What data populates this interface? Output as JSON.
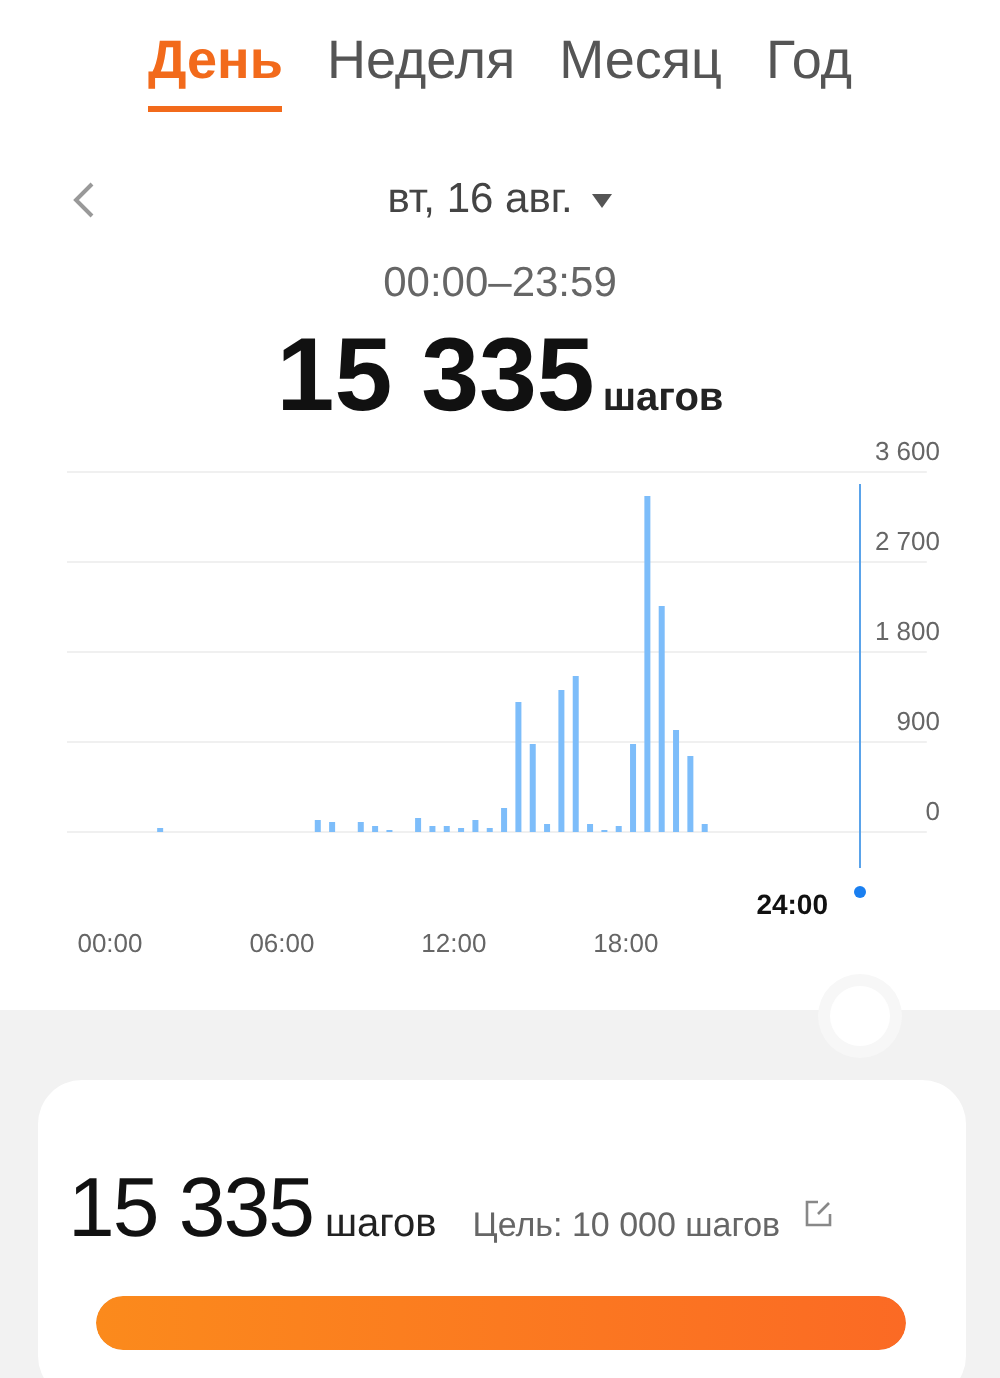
{
  "tabs": [
    {
      "label": "День",
      "selected": true
    },
    {
      "label": "Неделя",
      "selected": false
    },
    {
      "label": "Месяц",
      "selected": false
    },
    {
      "label": "Год",
      "selected": false
    }
  ],
  "date": "вт, 16 авг.",
  "time_range": "00:00–23:59",
  "total": {
    "value": "15 335",
    "unit": "шагов"
  },
  "chart": {
    "cursor_label": "24:00",
    "chart_data": {
      "type": "bar",
      "x": [
        1.75,
        7.25,
        7.75,
        8.75,
        9.25,
        9.75,
        10.75,
        11.25,
        11.75,
        12.25,
        12.75,
        13.25,
        13.75,
        14.25,
        14.75,
        15.25,
        15.75,
        16.25,
        16.75,
        17.25,
        17.75,
        18.25,
        18.75,
        19.25,
        19.75,
        20.25,
        20.75
      ],
      "values": [
        40,
        120,
        100,
        100,
        60,
        20,
        140,
        60,
        60,
        40,
        120,
        40,
        240,
        1300,
        880,
        80,
        1420,
        1560,
        80,
        20,
        60,
        880,
        3360,
        2260,
        1020,
        760,
        80
      ],
      "xlim": [
        -1.5,
        28.5
      ],
      "ylim": [
        0,
        3600
      ],
      "grid": true,
      "xticks": [
        {
          "value": 0,
          "label": "00:00"
        },
        {
          "value": 6,
          "label": "06:00"
        },
        {
          "value": 12,
          "label": "12:00"
        },
        {
          "value": 18,
          "label": "18:00"
        }
      ],
      "yticks": [
        {
          "value": 0,
          "label": "0"
        },
        {
          "value": 900,
          "label": "900"
        },
        {
          "value": 1800,
          "label": "1 800"
        },
        {
          "value": 2700,
          "label": "2 700"
        },
        {
          "value": 3600,
          "label": "3 600"
        }
      ]
    }
  },
  "summary": {
    "value": "15 335",
    "unit": "шагов",
    "goal": "Цель: 10 000 шагов",
    "level": 1
  }
}
